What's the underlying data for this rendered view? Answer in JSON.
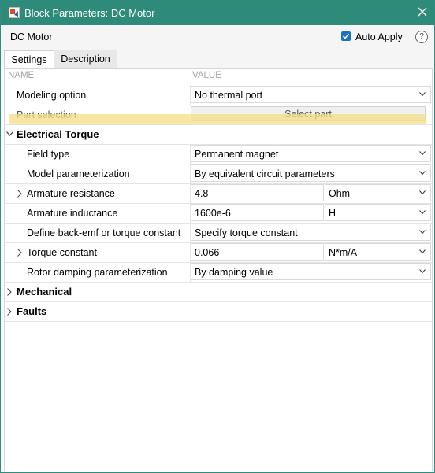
{
  "window": {
    "title": "Block Parameters: DC Motor"
  },
  "header": {
    "block_name": "DC Motor",
    "auto_apply_label": "Auto Apply",
    "auto_apply_checked": true,
    "help_symbol": "?"
  },
  "tabs": [
    {
      "label": "Settings",
      "active": true
    },
    {
      "label": "Description",
      "active": false
    }
  ],
  "columns": {
    "name": "NAME",
    "value": "VALUE"
  },
  "rows": {
    "modeling_option": {
      "label": "Modeling option",
      "value": "No thermal port"
    },
    "part_selection": {
      "label": "Part selection",
      "button": "Select part"
    },
    "electrical_torque": {
      "label": "Electrical Torque",
      "expanded": true
    },
    "field_type": {
      "label": "Field type",
      "value": "Permanent magnet"
    },
    "model_parameterization": {
      "label": "Model parameterization",
      "value": "By equivalent circuit parameters"
    },
    "armature_resistance": {
      "label": "Armature resistance",
      "value": "4.8",
      "unit": "Ohm"
    },
    "armature_inductance": {
      "label": "Armature inductance",
      "value": "1600e-6",
      "unit": "H"
    },
    "back_emf": {
      "label": "Define back-emf or torque constant",
      "value": "Specify torque constant"
    },
    "torque_constant": {
      "label": "Torque constant",
      "value": "0.066",
      "unit": "N*m/A"
    },
    "rotor_damping": {
      "label": "Rotor damping parameterization",
      "value": "By damping value"
    },
    "mechanical": {
      "label": "Mechanical",
      "expanded": false
    },
    "faults": {
      "label": "Faults",
      "expanded": false
    }
  },
  "colors": {
    "titlebar": "#2e8b7a",
    "checkbox": "#1a72c5",
    "highlight": "#f6dd86"
  }
}
